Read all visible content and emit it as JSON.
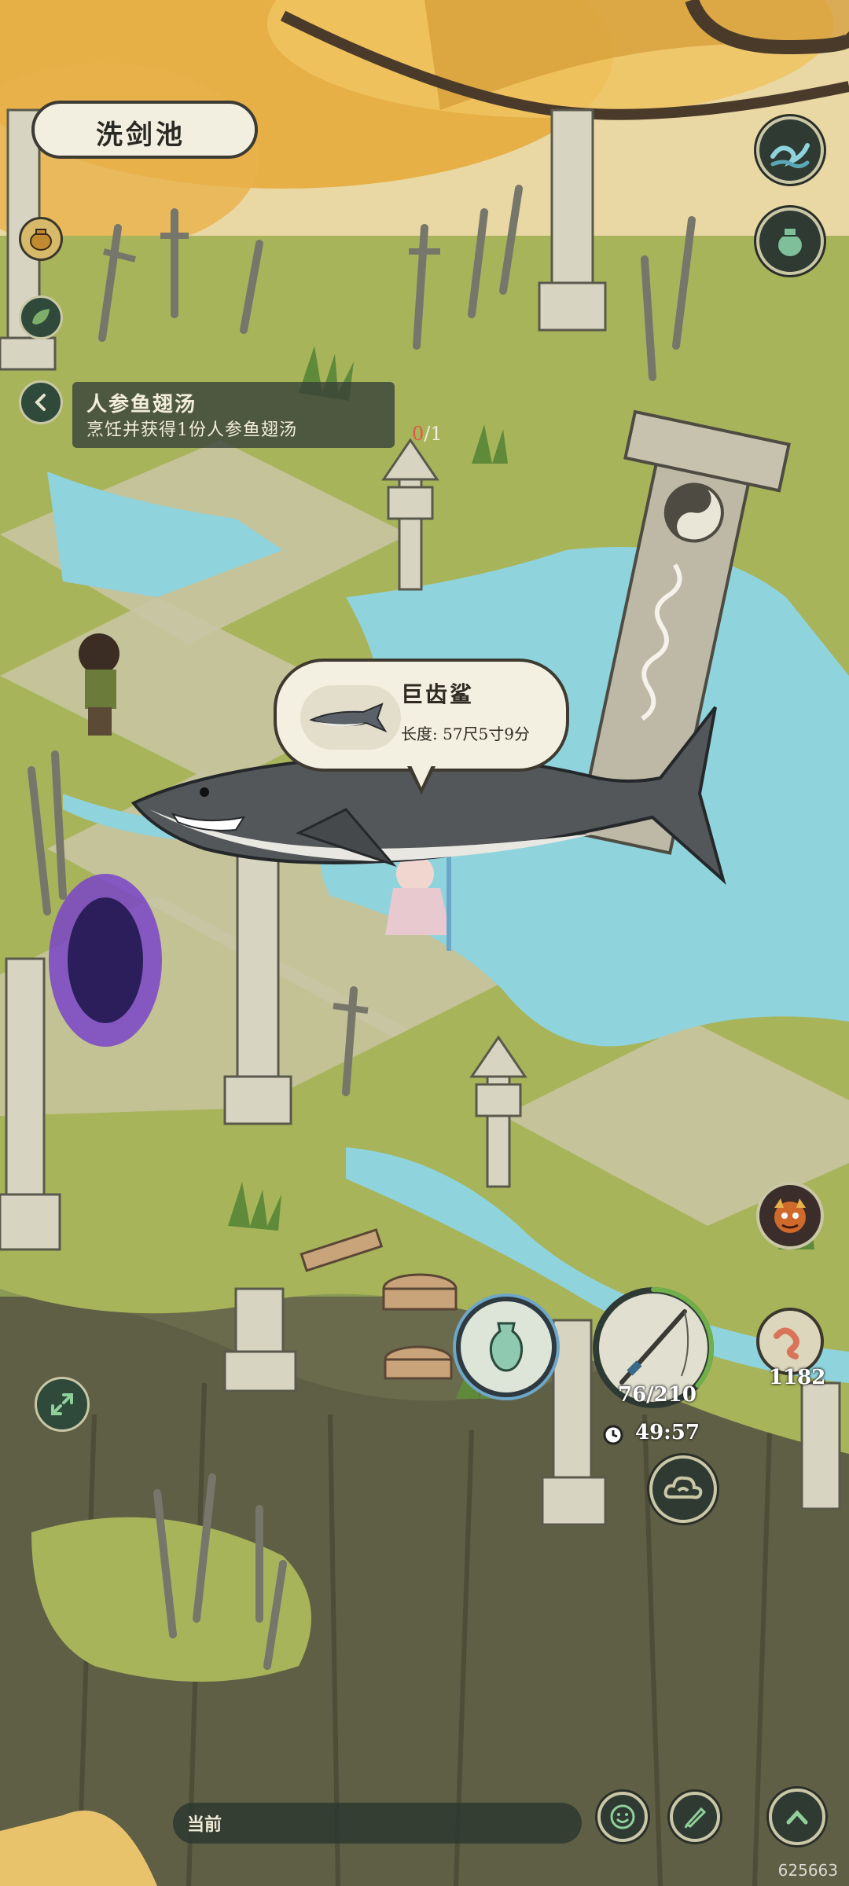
{
  "location": {
    "name": "洗剑池"
  },
  "quest": {
    "title": "人参鱼翅汤",
    "description": "烹饪并获得1份人参鱼翅汤",
    "progress_current": "0",
    "progress_total": "/1"
  },
  "catch": {
    "fish_name": "巨齿鲨",
    "length_text": "长度: 57尺5寸9分"
  },
  "fishing": {
    "rod_durability": "76/210",
    "timer": "49:57",
    "bait_count": "1182"
  },
  "chat": {
    "channel_label": "当前"
  },
  "watermark": "625663",
  "icons": {
    "top_right": [
      "wave-icon",
      "jar-icon"
    ],
    "left": [
      "pouch-icon",
      "leaf-icon",
      "back-arrow-icon"
    ],
    "bottom": [
      "vase-icon",
      "fishing-rod-icon",
      "clock-icon",
      "cloud-icon",
      "expand-icon",
      "smile-icon",
      "quill-icon",
      "up-arrow-icon"
    ]
  },
  "colors": {
    "button_dark": "#2f3a33",
    "water": "#8fd3dd",
    "grass": "#a8b45a",
    "autumn": "#e8b24a"
  }
}
